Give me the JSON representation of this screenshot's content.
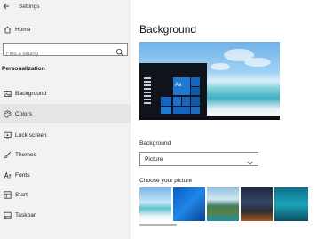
{
  "window": {
    "title": "Settings"
  },
  "sidebar": {
    "home_label": "Home",
    "search_placeholder": "Find a setting",
    "section_title": "Personalization",
    "items": [
      {
        "label": "Background",
        "icon": "image-icon",
        "selected": false
      },
      {
        "label": "Colors",
        "icon": "palette-icon",
        "selected": true
      },
      {
        "label": "Lock screen",
        "icon": "lock-screen-icon",
        "selected": false
      },
      {
        "label": "Themes",
        "icon": "brush-icon",
        "selected": false
      },
      {
        "label": "Fonts",
        "icon": "fonts-icon",
        "selected": false
      },
      {
        "label": "Start",
        "icon": "start-icon",
        "selected": false
      },
      {
        "label": "Taskbar",
        "icon": "taskbar-icon",
        "selected": false
      }
    ]
  },
  "main": {
    "page_title": "Background",
    "preview_tile_text": "Aa",
    "background_label": "Background",
    "background_value": "Picture",
    "choose_label": "Choose your picture",
    "pictures": [
      "beach",
      "windows-blue",
      "coast-rocks",
      "night-sky",
      "underwater"
    ]
  },
  "colors": {
    "accent": "#1565c0",
    "sidebar_bg": "#f2f2f2",
    "selected_bg": "#e5e5e5"
  }
}
